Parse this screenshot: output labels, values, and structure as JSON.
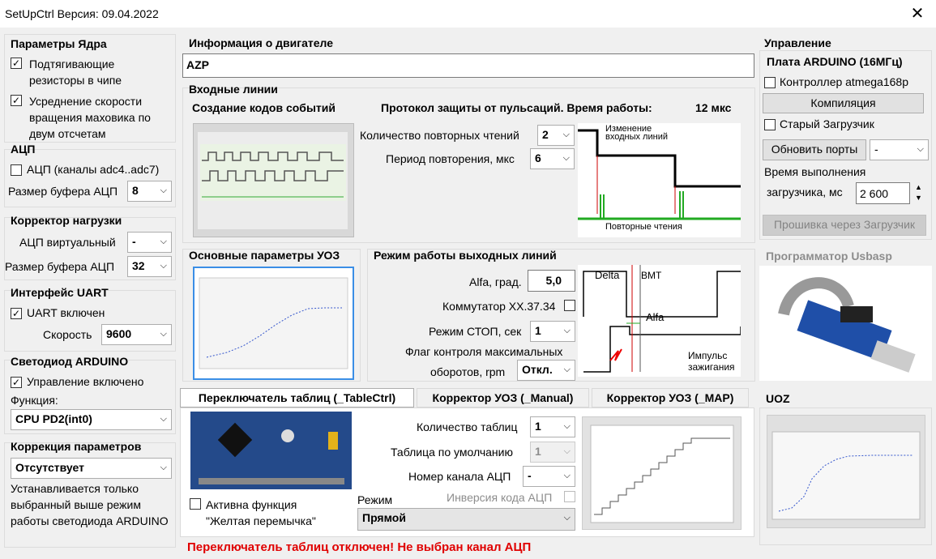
{
  "window": {
    "title": "SetUpCtrl  Версия: 09.04.2022",
    "close": "✕"
  },
  "core": {
    "title": "Параметры Ядра",
    "pullup": "Подтягивающие резисторы в чипе",
    "pullup_checked": true,
    "avg": "Усреднение скорости вращения маховика по двум отсчетам",
    "avg_checked": true
  },
  "adc": {
    "title": "АЦП",
    "channels": "АЦП (каналы adc4..adc7)",
    "channels_checked": false,
    "buffer_label": "Размер буфера АЦП",
    "buffer": "8"
  },
  "load": {
    "title": "Корректор нагрузки",
    "virtual_label": "АЦП виртуальный",
    "virtual": "-",
    "buffer_label": "Размер буфера АЦП",
    "buffer": "32"
  },
  "uart": {
    "title": "Интерфейс UART",
    "enabled": "UART включен",
    "enabled_checked": true,
    "speed_label": "Скорость",
    "speed": "9600"
  },
  "led": {
    "title": "Светодиод ARDUINO",
    "enabled": "Управление включено",
    "enabled_checked": true,
    "func_label": "Функция:",
    "func": "CPU PD2(int0)"
  },
  "corr": {
    "title": "Коррекция параметров",
    "value": "Отсутствует",
    "note": "Устанавливается только выбранный выше режим работы светодиода ARDUINO"
  },
  "engine": {
    "title": "Информация о двигателе",
    "value": "AZP"
  },
  "inputs": {
    "title": "Входные линии",
    "events": "Создание кодов событий",
    "protect": "Протокол защиты от пульсаций. Время работы:",
    "time": "12 мкс",
    "repeats_label": "Количество повторных чтений",
    "repeats": "2",
    "period_label": "Период повторения, мкс",
    "period": "6",
    "diag_top": "Изменение входных линий",
    "diag_bottom": "Повторные  чтения"
  },
  "uoz": {
    "title": "Основные параметры УОЗ"
  },
  "outputs": {
    "title": "Режим работы выходных линий",
    "alfa_label": "Alfa, град.",
    "alfa": "5,0",
    "comm_label": "Коммутатор ХХ.37.34",
    "comm_checked": false,
    "stop_label": "Режим СТОП, сек",
    "stop": "1",
    "flag_label1": "Флаг контроля максимальных",
    "flag_label2": "оборотов, rpm",
    "flag": "Откл.",
    "d_delta": "Delta",
    "d_bmt": "ВМТ",
    "d_alfa": "Alfa",
    "d_impulse1": "Импульс",
    "d_impulse2": "зажигания"
  },
  "tabs": [
    "Переключатель таблиц (_TableCtrl)",
    "Корректор УОЗ (_Manual)",
    "Корректор УОЗ (_MAP)"
  ],
  "tablectrl": {
    "count_label": "Количество таблиц",
    "count": "1",
    "default_label": "Таблица по умолчанию",
    "default": "1",
    "channel_label": "Номер канала АЦП",
    "channel": "-",
    "invert_label": "Инверсия кода АЦП",
    "mode_label": "Режим",
    "mode": "Прямой",
    "yellow": "Активна функция \"Желтая перемычка\"",
    "warning": "Переключатель таблиц отключен! Не выбран канал АЦП"
  },
  "control": {
    "title": "Управление",
    "board": "Плата ARDUINO (16МГц)",
    "atmega": "Контроллер atmega168p",
    "compile": "Компиляция",
    "oldloader": "Старый Загрузчик",
    "refresh": "Обновить порты",
    "port": "-",
    "exec_label1": "Время выполнения",
    "exec_label2": "загрузчика, мс",
    "exec": "2 600",
    "flash": "Прошивка через Загрузчик",
    "programmer": "Программатор Usbasp",
    "uoz": "UOZ"
  },
  "icons": {
    "check": "✓",
    "arrow": "⌵"
  }
}
